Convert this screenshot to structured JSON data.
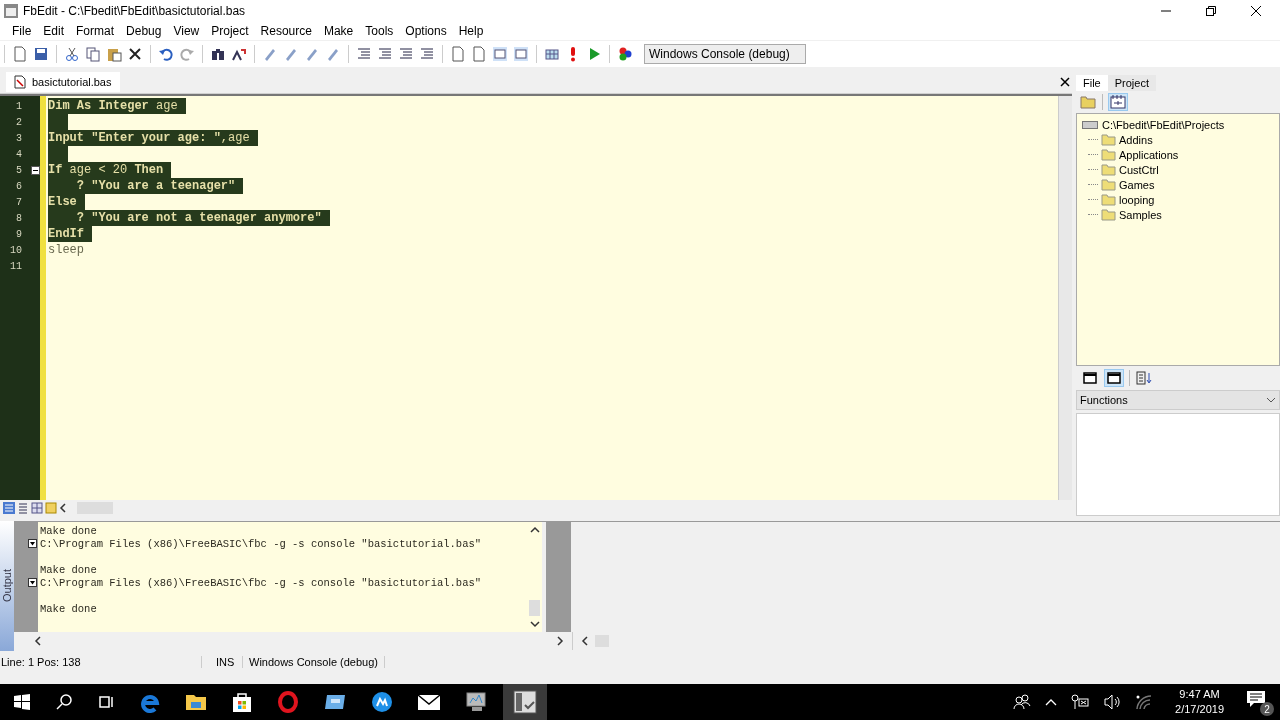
{
  "window": {
    "title": "FbEdit - C:\\Fbedit\\FbEdit\\basictutorial.bas"
  },
  "menu": [
    "File",
    "Edit",
    "Format",
    "Debug",
    "View",
    "Project",
    "Resource",
    "Make",
    "Tools",
    "Options",
    "Help"
  ],
  "build_target": "Windows Console (debug)",
  "document_tab": {
    "label": "basictutorial.bas"
  },
  "editor": {
    "lines": [
      {
        "number": "1",
        "text": "**Dim As Integer** age",
        "selected": true
      },
      {
        "number": "2",
        "selected": true
      },
      {
        "number": "3",
        "text": "**Input \"Enter your age: \"**,age",
        "selected": true
      },
      {
        "number": "4",
        "selected": true
      },
      {
        "number": "5",
        "text": "**If** age < 20 **Then**",
        "selected": true,
        "fold": true
      },
      {
        "number": "6",
        "text": "    **? \"You are a teenager\"**",
        "selected": true
      },
      {
        "number": "7",
        "text": "**Else**",
        "selected": true
      },
      {
        "number": "8",
        "text": "    **? \"You are not a teenager anymore\"**",
        "selected": true
      },
      {
        "number": "9",
        "text": "**EndIf**",
        "selected": true
      },
      {
        "number": "10",
        "text": "sleep",
        "selected": false
      },
      {
        "number": "11",
        "selected": false
      }
    ]
  },
  "side_panel": {
    "tabs": [
      {
        "label": "File",
        "selected": true
      },
      {
        "label": "Project",
        "selected": false
      }
    ],
    "tree": {
      "label": "C:\\Fbedit\\FbEdit\\Projects",
      "children": [
        {
          "label": "Addins"
        },
        {
          "label": "Applications"
        },
        {
          "label": "CustCtrl"
        },
        {
          "label": "Games"
        },
        {
          "label": "looping"
        },
        {
          "label": "Samples"
        }
      ]
    },
    "view_buttons": [
      {
        "selected": false
      },
      {
        "selected": true
      }
    ],
    "functions_dropdown": "Functions"
  },
  "output": {
    "title": "Output",
    "lines": [
      {
        "kind": "text",
        "text": "Make done"
      },
      {
        "kind": "command",
        "text": "C:\\Program Files (x86)\\FreeBASIC\\fbc -g -s console \"basictutorial.bas\""
      },
      {
        "kind": "blank"
      },
      {
        "kind": "text",
        "text": "Make done"
      },
      {
        "kind": "command",
        "text": "C:\\Program Files (x86)\\FreeBASIC\\fbc -g -s console \"basictutorial.bas\""
      },
      {
        "kind": "blank"
      },
      {
        "kind": "text",
        "text": "Make done"
      }
    ]
  },
  "status_bar": {
    "position": "Line: 1 Pos: 138",
    "mode": "INS",
    "target": "Windows Console (debug)"
  },
  "taskbar": {
    "clock_time": "9:47 AM",
    "clock_date": "2/17/2019",
    "notification_count": "2"
  }
}
